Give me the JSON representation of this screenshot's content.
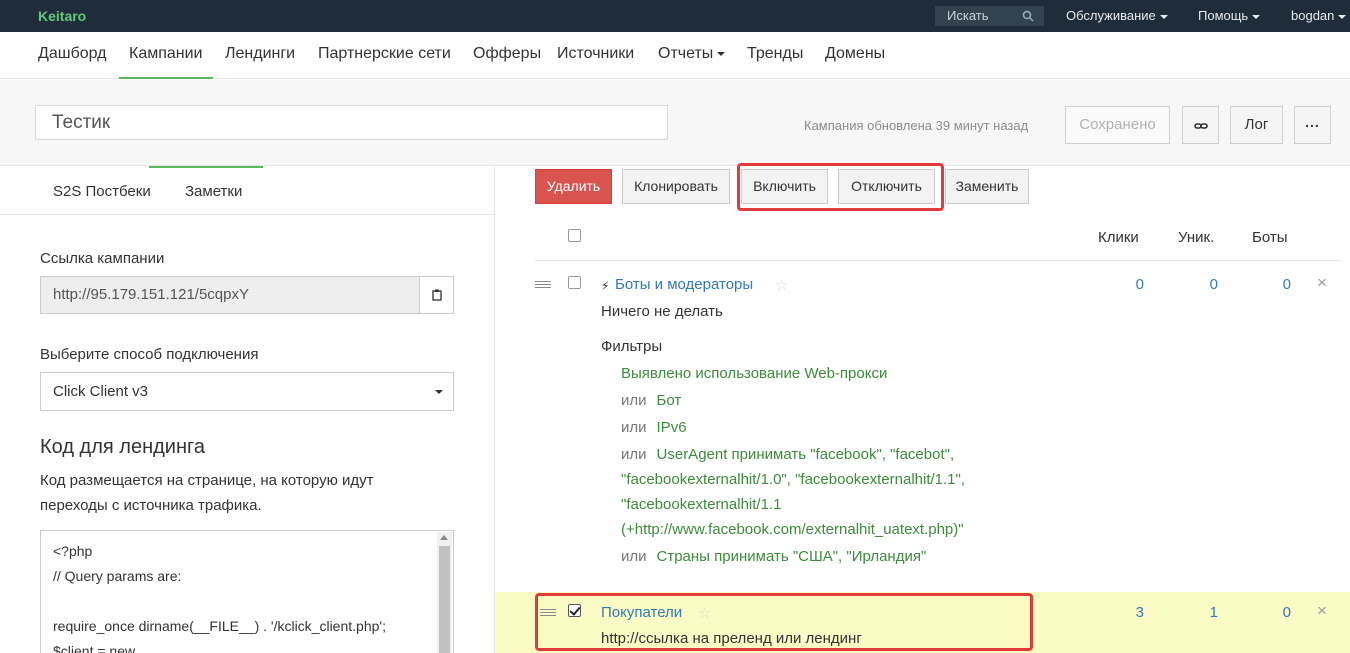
{
  "app": {
    "logo": "Keitaro"
  },
  "topbar": {
    "search_placeholder": "Искать",
    "menu": [
      {
        "label": "Обслуживание"
      },
      {
        "label": "Помощь"
      },
      {
        "label": "bogdan"
      }
    ]
  },
  "nav": {
    "items": [
      {
        "label": "Дашборд"
      },
      {
        "label": "Кампании"
      },
      {
        "label": "Лендинги"
      },
      {
        "label": "Партнерские сети"
      },
      {
        "label": "Офферы"
      },
      {
        "label": "Источники"
      },
      {
        "label": "Отчеты"
      },
      {
        "label": "Тренды"
      },
      {
        "label": "Домены"
      }
    ],
    "active": "Кампании"
  },
  "campaign": {
    "name": "Тестик",
    "updated": "Кампания обновлена 39 минут назад",
    "saved_label": "Сохранено",
    "log_label": "Лог",
    "more_label": "..."
  },
  "left": {
    "tabs": [
      {
        "label": "S2S Постбеки"
      },
      {
        "label": "Заметки"
      }
    ],
    "link_label": "Ссылка кампании",
    "link_value": "http://95.179.151.121/5cqpxY",
    "connect_label": "Выберите способ подключения",
    "connect_value": "Click Client v3",
    "code_heading": "Код для лендинга",
    "code_desc": "Код размещается на странице, на которую идут переходы с источника трафика.",
    "code_lines": [
      "<?php",
      "// Query params are:",
      "",
      "require_once dirname(__FILE__) . '/kclick_client.php';",
      "$client = new"
    ]
  },
  "actions": {
    "delete": "Удалить",
    "clone": "Клонировать",
    "enable": "Включить",
    "disable": "Отключить",
    "replace": "Заменить"
  },
  "columns": {
    "clicks": "Клики",
    "unique": "Уник.",
    "bots": "Боты"
  },
  "flows": [
    {
      "title": "Боты и модераторы",
      "action": "Ничего не делать",
      "filters_label": "Фильтры",
      "clicks": "0",
      "unique": "0",
      "bots": "0",
      "filters": [
        {
          "or": "",
          "text": "Выявлено использование Web-прокси"
        },
        {
          "or": "или",
          "text": "Бот"
        },
        {
          "or": "или",
          "text": "IPv6"
        },
        {
          "or": "или",
          "text": "UserAgent принимать \"facebook\", \"facebot\","
        },
        {
          "or": "",
          "text": "\"facebookexternalhit/1.0\", \"facebookexternalhit/1.1\","
        },
        {
          "or": "",
          "text": "\"facebookexternalhit/1.1"
        },
        {
          "or": "",
          "text": "(+http://www.facebook.com/externalhit_uatext.php)\""
        },
        {
          "or": "или",
          "text": "Страны принимать \"США\", \"Ирландия\""
        }
      ]
    },
    {
      "title": "Покупатели",
      "action": "http://ссылка на преленд или лендинг",
      "clicks": "3",
      "unique": "1",
      "bots": "0"
    }
  ],
  "colors": {
    "accent_green": "#5cb85c",
    "link_blue": "#337ab7",
    "danger": "#d9534f",
    "highlight": "#e03a3a",
    "row_yellow": "#fbfbc6"
  }
}
